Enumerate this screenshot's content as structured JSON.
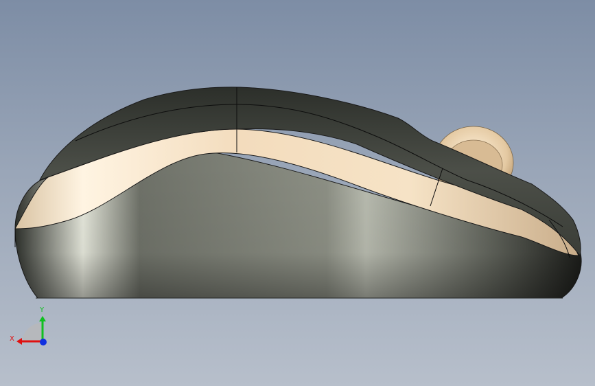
{
  "view": {
    "background_top": "#7d8da5",
    "background_bottom": "#b7bfcb",
    "model": "mouse-side-view"
  },
  "triad": {
    "x_label": "X",
    "y_label": "Y",
    "x_color": "#e01010",
    "y_color": "#10c020",
    "z_color": "#1030e0"
  }
}
